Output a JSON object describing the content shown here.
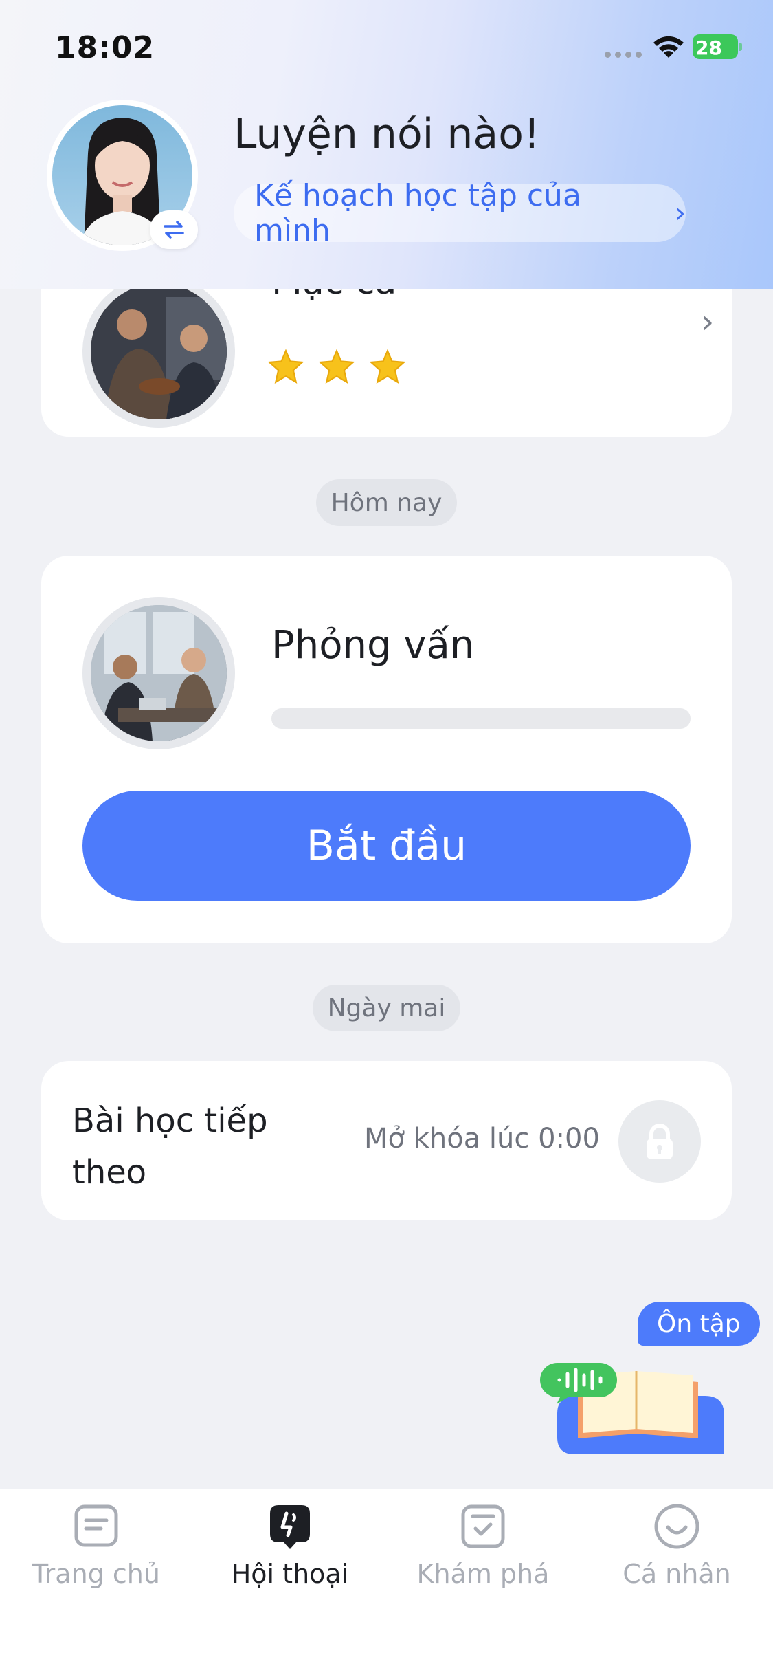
{
  "status_bar": {
    "time": "18:02",
    "battery": "28"
  },
  "header": {
    "greeting": "Luyện nói nào!",
    "plan_link": "Kế hoạch học tập của mình",
    "plan_chevron": "›"
  },
  "lessons": {
    "previous": {
      "title": "Mặc cả",
      "stars": 3,
      "chevron": "›"
    },
    "today_label": "Hôm nay",
    "today": {
      "title": "Phỏng vấn",
      "progress": 0,
      "button": "Bắt đầu"
    },
    "tomorrow_label": "Ngày mai",
    "next": {
      "title": "Bài học tiếp theo",
      "unlock_text": "Mở khóa lúc 0:00"
    }
  },
  "review": {
    "label": "Ôn tập"
  },
  "tabs": [
    {
      "label": "Trang chủ",
      "icon": "home-doc-icon",
      "active": false
    },
    {
      "label": "Hội thoại",
      "icon": "chat-bubble-icon",
      "active": true
    },
    {
      "label": "Khám phá",
      "icon": "explore-check-icon",
      "active": false
    },
    {
      "label": "Cá nhân",
      "icon": "smile-profile-icon",
      "active": false
    }
  ],
  "colors": {
    "accent": "#4d7bfb",
    "star": "#f7c21b",
    "background": "#f0f1f5"
  }
}
